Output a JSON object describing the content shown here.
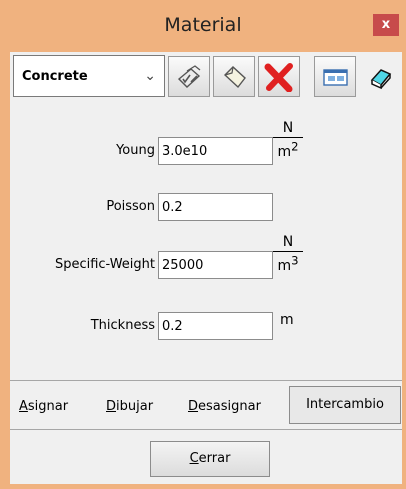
{
  "window": {
    "title": "Material",
    "close_label": "x"
  },
  "toolbar": {
    "material_select": {
      "value": "Concrete"
    },
    "buttons": [
      {
        "icon": "edit-checklist-icon"
      },
      {
        "icon": "new-material-icon"
      },
      {
        "icon": "delete-icon"
      },
      {
        "icon": "dialog-icon"
      },
      {
        "icon": "eraser-icon"
      }
    ]
  },
  "fields": {
    "young": {
      "label": "Young",
      "value": "3.0e10",
      "unit_num": "N",
      "unit_den": "m",
      "unit_exp": "2"
    },
    "poisson": {
      "label": "Poisson",
      "value": "0.2"
    },
    "specific_weight": {
      "label": "Specific-Weight",
      "value": "25000",
      "unit_num": "N",
      "unit_den": "m",
      "unit_exp": "3"
    },
    "thickness": {
      "label": "Thickness",
      "value": "0.2",
      "unit": "m"
    }
  },
  "actions": {
    "assign": {
      "first": "A",
      "rest": "signar"
    },
    "draw": {
      "first": "D",
      "rest": "ibujar"
    },
    "unassign": {
      "first": "D",
      "rest": "esasignar"
    },
    "exchange": "Intercambio",
    "close": {
      "first": "C",
      "rest": "errar"
    }
  },
  "colors": {
    "titlebar": "#f0b27f",
    "close": "#c74b4b",
    "client": "#f0f0f0"
  }
}
